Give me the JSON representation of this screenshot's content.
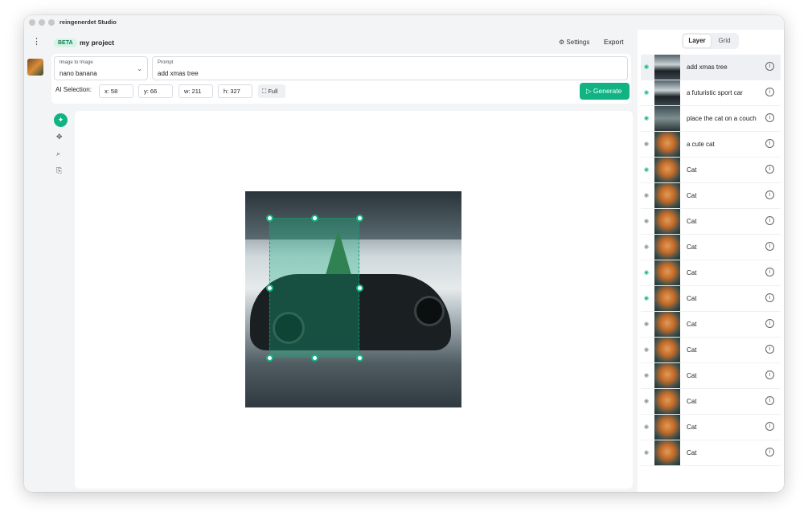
{
  "window": {
    "title": "reingenerdet Studio"
  },
  "header": {
    "badge": "BETA",
    "project": "my project",
    "settings": "Settings",
    "export": "Export"
  },
  "params": {
    "mode_label": "Image to Image",
    "mode_value": "nano banana",
    "prompt_label": "Prompt",
    "prompt_value": "add xmas tree",
    "selection_label": "AI Selection:",
    "x": "x: 58",
    "y": "y: 66",
    "w": "w: 211",
    "h": "h: 327",
    "full": "Full",
    "generate": "Generate"
  },
  "tools": {
    "icons": [
      "ai-select-icon",
      "move-icon",
      "zoom-icon",
      "crop-icon"
    ]
  },
  "panel": {
    "tabs": [
      "Layer",
      "Grid"
    ],
    "active_tab": "Layer",
    "layers": [
      {
        "name": "add xmas tree",
        "visible": true,
        "selected": true,
        "thumb": "car"
      },
      {
        "name": "a futuristic sport car",
        "visible": true,
        "thumb": "car"
      },
      {
        "name": "place the cat on a couch",
        "visible": true,
        "thumb": "garage"
      },
      {
        "name": "a cute cat",
        "visible": false,
        "thumb": "cat"
      },
      {
        "name": "Cat",
        "visible": true,
        "thumb": "cat"
      },
      {
        "name": "Cat",
        "visible": false,
        "thumb": "cat"
      },
      {
        "name": "Cat",
        "visible": false,
        "thumb": "cat"
      },
      {
        "name": "Cat",
        "visible": false,
        "thumb": "cat"
      },
      {
        "name": "Cat",
        "visible": true,
        "thumb": "cat"
      },
      {
        "name": "Cat",
        "visible": true,
        "thumb": "cat"
      },
      {
        "name": "Cat",
        "visible": false,
        "thumb": "cat"
      },
      {
        "name": "Cat",
        "visible": false,
        "thumb": "cat"
      },
      {
        "name": "Cat",
        "visible": false,
        "thumb": "cat"
      },
      {
        "name": "Cat",
        "visible": false,
        "thumb": "cat"
      },
      {
        "name": "Cat",
        "visible": false,
        "thumb": "cat"
      },
      {
        "name": "Cat",
        "visible": false,
        "thumb": "cat"
      }
    ]
  },
  "colors": {
    "accent": "#12b383",
    "selection": "#0e9b70"
  }
}
